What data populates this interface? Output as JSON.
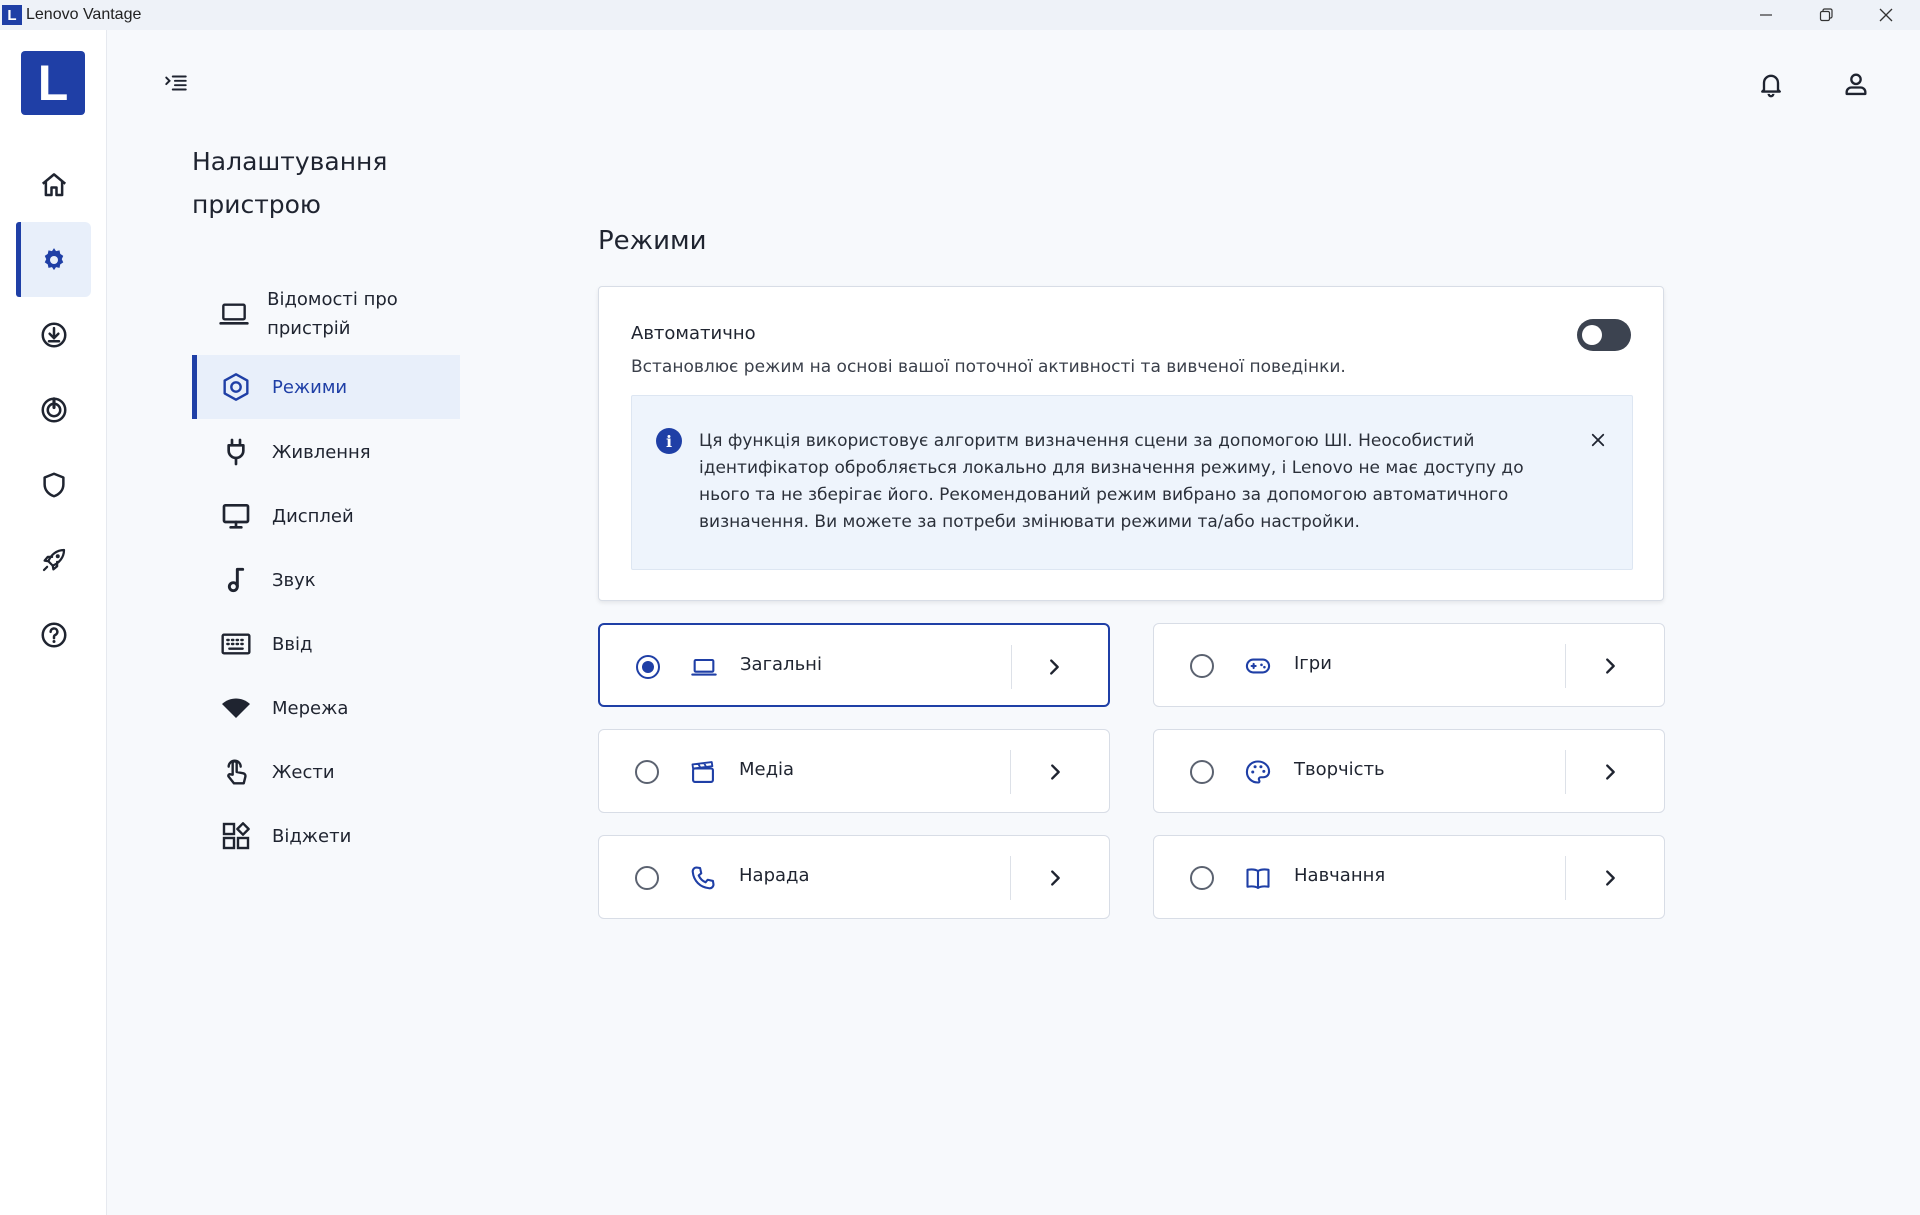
{
  "window": {
    "logo_letter": "L",
    "title": "Lenovo Vantage"
  },
  "rail": {
    "brand_letter": "L",
    "items": [
      {
        "name": "home-icon"
      },
      {
        "name": "gear-icon"
      },
      {
        "name": "download-icon"
      },
      {
        "name": "power-circle-icon"
      },
      {
        "name": "shield-icon"
      },
      {
        "name": "rocket-icon"
      },
      {
        "name": "help-icon"
      }
    ]
  },
  "section": {
    "title": "Налаштування пристрою"
  },
  "subnav": {
    "items": [
      {
        "label": "Відомості про пристрій",
        "icon": "laptop-icon"
      },
      {
        "label": "Режими",
        "icon": "hexagon-icon"
      },
      {
        "label": "Живлення",
        "icon": "plug-icon"
      },
      {
        "label": "Дисплей",
        "icon": "monitor-icon"
      },
      {
        "label": "Звук",
        "icon": "music-note-icon"
      },
      {
        "label": "Ввід",
        "icon": "keyboard-icon"
      },
      {
        "label": "Мережа",
        "icon": "wifi-icon"
      },
      {
        "label": "Жести",
        "icon": "touch-icon"
      },
      {
        "label": "Віджети",
        "icon": "widgets-icon"
      }
    ]
  },
  "main": {
    "title": "Режими",
    "auto": {
      "title": "Автоматично",
      "description": "Встановлює режим на основі вашої поточної активності та вивченої поведінки.",
      "toggle_on": false,
      "info_text": "Ця функція використовує алгоритм визначення сцени за допомогою ШІ. Неособистий ідентифікатор обробляється локально для визначення режиму, і Lenovo не має доступу до нього та не зберігає його. Рекомендований режим вибрано за допомогою автоматичного визначення. Ви можете за потреби змінювати режими та/або настройки."
    },
    "modes": [
      {
        "label": "Загальні",
        "icon": "laptop-icon",
        "selected": true
      },
      {
        "label": "Ігри",
        "icon": "gamepad-icon",
        "selected": false
      },
      {
        "label": "Медіа",
        "icon": "clapperboard-icon",
        "selected": false
      },
      {
        "label": "Творчість",
        "icon": "palette-icon",
        "selected": false
      },
      {
        "label": "Нарада",
        "icon": "phone-icon",
        "selected": false
      },
      {
        "label": "Навчання",
        "icon": "book-icon",
        "selected": false
      }
    ]
  },
  "colors": {
    "accent": "#1f3fa6",
    "active_bg": "#e8effa",
    "info_bg": "#eef4fc"
  }
}
